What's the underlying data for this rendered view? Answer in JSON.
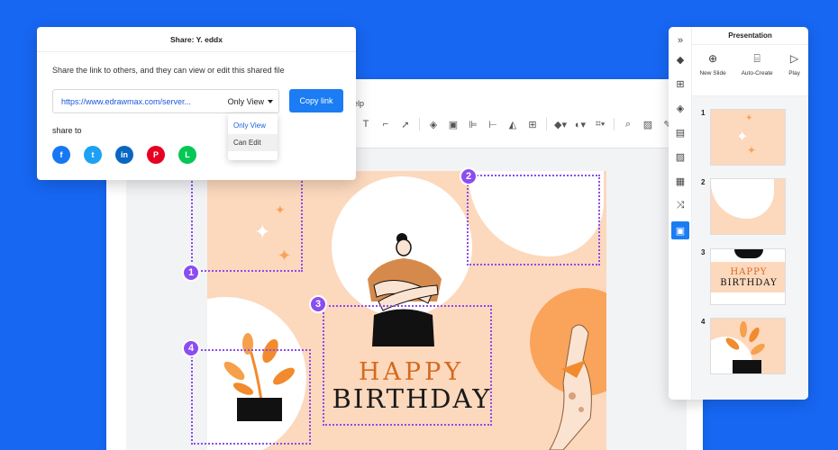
{
  "share_dialog": {
    "title": "Share: Y. eddx",
    "description": "Share the link to others, and they can view or edit this shared file",
    "link_url": "https://www.edrawmax.com/server...",
    "permission_selected": "Only View",
    "copy_button": "Copy link",
    "share_to_label": "share to",
    "permission_options": [
      "Only View",
      "Can Edit"
    ],
    "socials": [
      {
        "name": "facebook-icon",
        "glyph": "f",
        "color": "#1877f2"
      },
      {
        "name": "twitter-icon",
        "glyph": "t",
        "color": "#1da1f2"
      },
      {
        "name": "linkedin-icon",
        "glyph": "in",
        "color": "#0a66c2"
      },
      {
        "name": "pinterest-icon",
        "glyph": "P",
        "color": "#e60023"
      },
      {
        "name": "line-icon",
        "glyph": "L",
        "color": "#06c755"
      }
    ]
  },
  "editor": {
    "menu_fragment": "elp"
  },
  "card": {
    "happy": "HAPPY",
    "birthday": "BIRTHDAY"
  },
  "selection_badges": [
    "1",
    "2",
    "3",
    "4"
  ],
  "presentation": {
    "title": "Presentation",
    "actions": [
      {
        "label": "New Slide",
        "icon": "plus-circle-icon"
      },
      {
        "label": "Auto-Create",
        "icon": "auto-create-icon"
      },
      {
        "label": "Play",
        "icon": "play-icon"
      }
    ],
    "slides": [
      {
        "number": "1"
      },
      {
        "number": "2"
      },
      {
        "number": "3",
        "happy": "HAPPY",
        "birthday": "BIRTHDAY"
      },
      {
        "number": "4"
      }
    ]
  },
  "colors": {
    "background": "#1767f3",
    "accent": "#8b4cf0",
    "card": "#fcd8bd",
    "button": "#1b7cf4"
  }
}
